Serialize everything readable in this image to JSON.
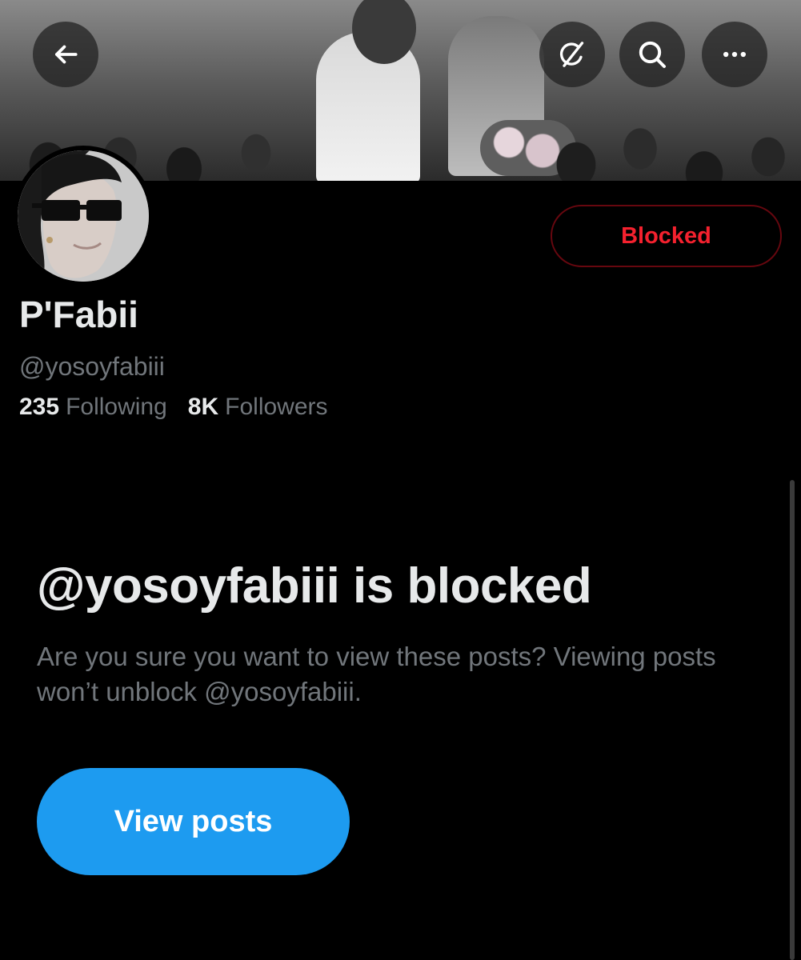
{
  "header": {
    "back_icon": "arrow-left-icon",
    "grok_icon": "grok-icon",
    "search_icon": "search-icon",
    "more_icon": "more-horizontal-icon"
  },
  "profile": {
    "display_name": "P'Fabii",
    "handle": "@yosoyfabiii",
    "action_button_label": "Blocked",
    "stats": {
      "following_count": "235",
      "following_label": "Following",
      "followers_count": "8K",
      "followers_label": "Followers"
    }
  },
  "blocked_notice": {
    "title": "@yosoyfabiii is blocked",
    "description": "Are you sure you want to view these posts? Viewing posts won’t unblock @yosoyfabiii.",
    "button_label": "View posts"
  },
  "colors": {
    "background": "#000000",
    "primary_text": "#e7e9ea",
    "secondary_text": "#71767b",
    "accent_blue": "#1d9bf0",
    "blocked_red": "#f4212e",
    "blocked_border": "#67070f"
  }
}
